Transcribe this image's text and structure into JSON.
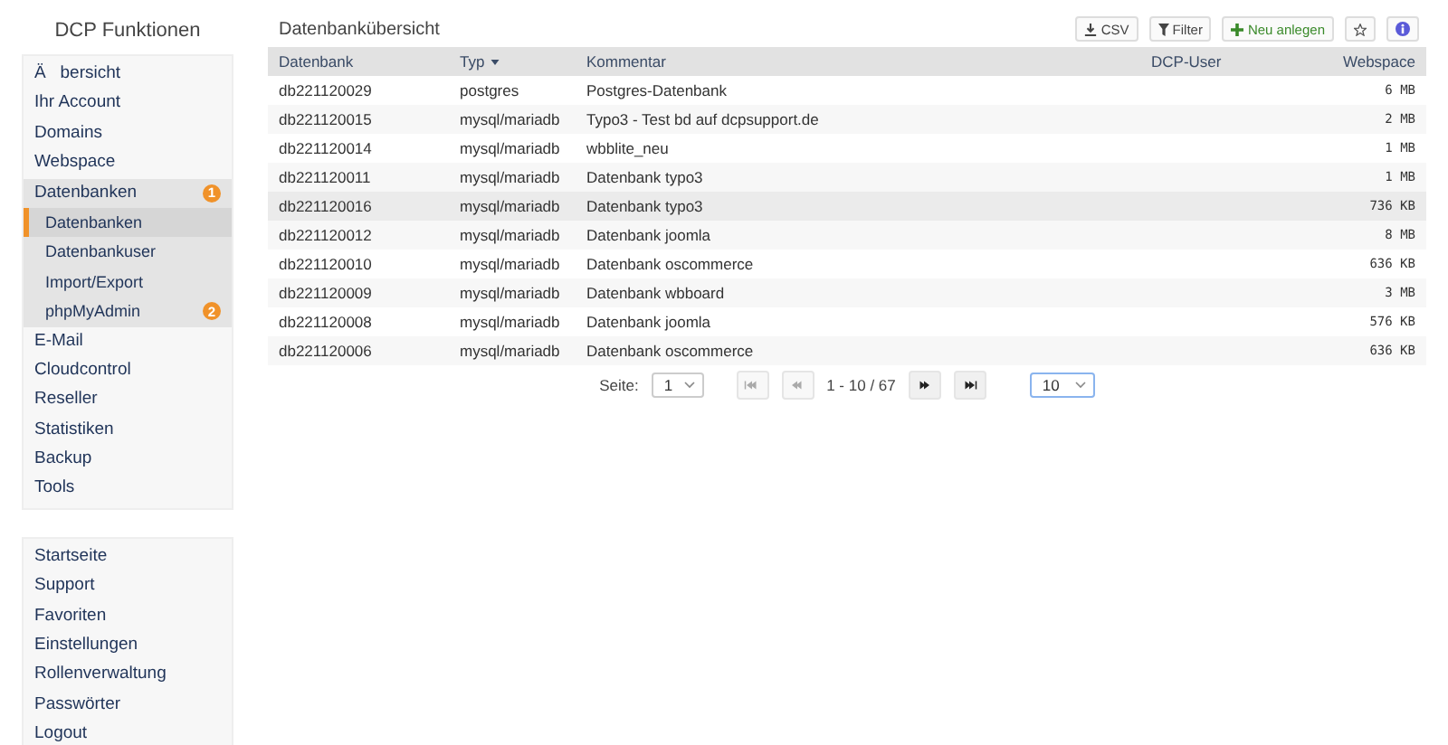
{
  "sidebar": {
    "title": "DCP Funktionen",
    "items": [
      {
        "label": "Ä   bersicht",
        "expanded": false
      },
      {
        "label": "Ihr Account",
        "expanded": false
      },
      {
        "label": "Domains",
        "expanded": false
      },
      {
        "label": "Webspace",
        "expanded": false
      },
      {
        "label": "Datenbanken",
        "expanded": true,
        "badge": "1",
        "children": [
          {
            "label": "Datenbanken",
            "selected": true
          },
          {
            "label": "Datenbankuser",
            "selected": false
          },
          {
            "label": "Import/Export",
            "selected": false
          },
          {
            "label": "phpMyAdmin",
            "selected": false,
            "badge": "2"
          }
        ]
      },
      {
        "label": "E-Mail",
        "expanded": false
      },
      {
        "label": "Cloudcontrol",
        "expanded": false
      },
      {
        "label": "Reseller",
        "expanded": false
      },
      {
        "label": "Statistiken",
        "expanded": false
      },
      {
        "label": "Backup",
        "expanded": false
      },
      {
        "label": "Tools",
        "expanded": false
      }
    ],
    "footer_items": [
      "Startseite",
      "Support",
      "Favoriten",
      "Einstellungen",
      "Rollenverwaltung",
      "Passwörter",
      "Logout"
    ]
  },
  "main": {
    "title": "Datenbankübersicht",
    "toolbar": [
      {
        "kind": "csv",
        "label": "CSV"
      },
      {
        "kind": "filter",
        "label": "Filter"
      },
      {
        "kind": "new",
        "label": "Neu anlegen"
      },
      {
        "kind": "star"
      },
      {
        "kind": "info"
      }
    ],
    "table": {
      "columns": [
        {
          "label": "Datenbank",
          "sorted": false
        },
        {
          "label": "Typ",
          "sorted": true
        },
        {
          "label": "Kommentar",
          "sorted": false
        },
        {
          "label": "DCP-User",
          "sorted": false
        },
        {
          "label": "Webspace",
          "sorted": false
        }
      ],
      "rows": [
        {
          "cells": [
            "db221120029",
            "postgres",
            "Postgres-Datenbank",
            "",
            "6 MB"
          ],
          "highlighted": false
        },
        {
          "cells": [
            "db221120015",
            "mysql/mariadb",
            "Typo3 - Test bd auf dcpsupport.de",
            "",
            "2 MB"
          ],
          "highlighted": false
        },
        {
          "cells": [
            "db221120014",
            "mysql/mariadb",
            "wbblite_neu",
            "",
            "1 MB"
          ],
          "highlighted": false
        },
        {
          "cells": [
            "db221120011",
            "mysql/mariadb",
            "Datenbank typo3",
            "",
            "1 MB"
          ],
          "highlighted": false
        },
        {
          "cells": [
            "db221120016",
            "mysql/mariadb",
            "Datenbank typo3",
            "",
            "736 KB"
          ],
          "highlighted": true
        },
        {
          "cells": [
            "db221120012",
            "mysql/mariadb",
            "Datenbank joomla",
            "",
            "8 MB"
          ],
          "highlighted": false
        },
        {
          "cells": [
            "db221120010",
            "mysql/mariadb",
            "Datenbank oscommerce",
            "",
            "636 KB"
          ],
          "highlighted": false
        },
        {
          "cells": [
            "db221120009",
            "mysql/mariadb",
            "Datenbank wbboard",
            "",
            "3 MB"
          ],
          "highlighted": false
        },
        {
          "cells": [
            "db221120008",
            "mysql/mariadb",
            "Datenbank joomla",
            "",
            "576 KB"
          ],
          "highlighted": false
        },
        {
          "cells": [
            "db221120006",
            "mysql/mariadb",
            "Datenbank oscommerce",
            "",
            "636 KB"
          ],
          "highlighted": false
        }
      ]
    },
    "pagination": {
      "page_label": "Seite:",
      "page": "1",
      "first_disabled": true,
      "prev_disabled": true,
      "next_disabled": false,
      "last_disabled": false,
      "range": "1 - 10 / 67",
      "per_page": "10"
    }
  }
}
